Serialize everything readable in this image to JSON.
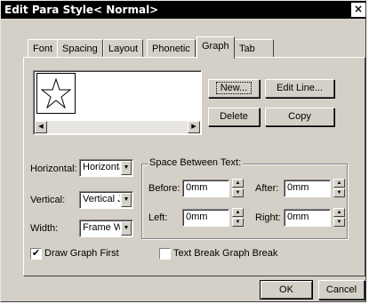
{
  "dialog": {
    "title": "Edit Para Style< Normal>",
    "close_glyph": "×"
  },
  "tabs": [
    {
      "label": "Font",
      "active": false
    },
    {
      "label": "Spacing",
      "active": false
    },
    {
      "label": "Layout",
      "active": false
    },
    {
      "label": "Phonetic",
      "active": false
    },
    {
      "label": "Graph",
      "active": true
    },
    {
      "label": "Tab",
      "active": false
    }
  ],
  "graph_buttons": {
    "new": "New...",
    "edit_line": "Edit Line...",
    "delete": "Delete",
    "copy": "Copy"
  },
  "position": {
    "horizontal_label": "Horizontal:",
    "horizontal_value": "Horizontal",
    "vertical_label": "Vertical:",
    "vertical_value": "Vertical J",
    "width_label": "Width:",
    "width_value": "Frame W"
  },
  "space_between": {
    "group_label": "Space Between Text:",
    "before_label": "Before:",
    "before_value": "0mm",
    "after_label": "After:",
    "after_value": "0mm",
    "left_label": "Left:",
    "left_value": "0mm",
    "right_label": "Right:",
    "right_value": "0mm"
  },
  "options": {
    "draw_graph_first_label": "Draw Graph First",
    "draw_graph_first_checked": true,
    "text_break_label": "Text Break Graph Break",
    "text_break_checked": false
  },
  "footer": {
    "ok": "OK",
    "cancel": "Cancel"
  }
}
